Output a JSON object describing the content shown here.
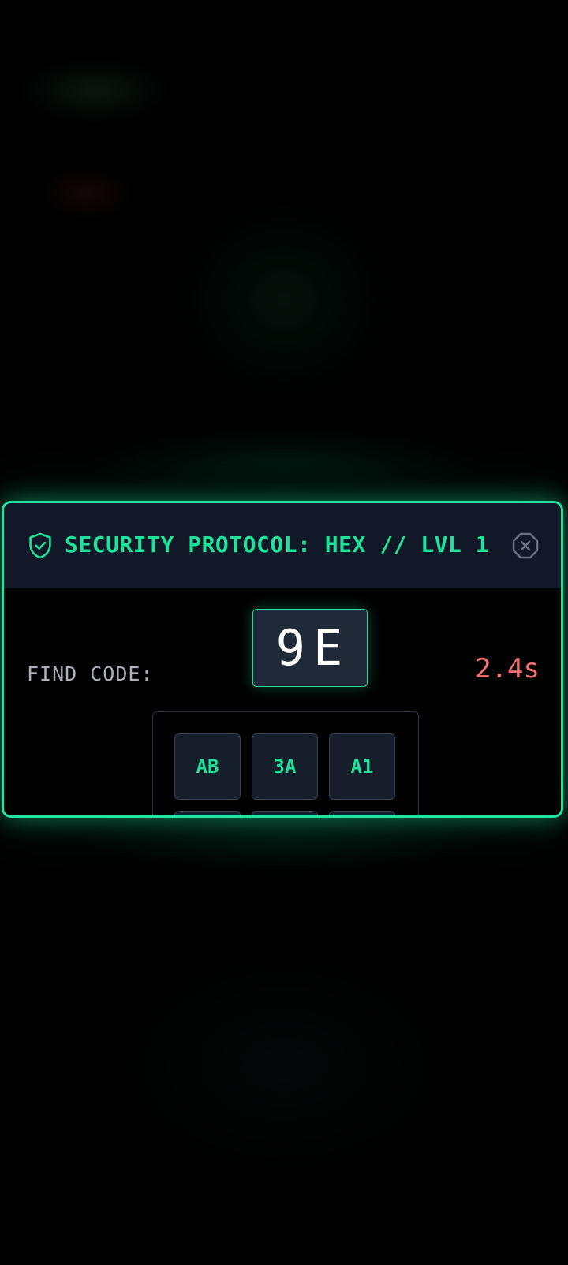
{
  "modal": {
    "title": "SECURITY PROTOCOL: HEX // LVL 1",
    "header_icon": "shield-check-icon",
    "close_icon": "close-octagon-icon",
    "find_label": "FIND CODE:",
    "target_code": "9E",
    "timer": "2.4s",
    "grid": {
      "visible_row": [
        "AB",
        "3A",
        "A1"
      ]
    }
  },
  "colors": {
    "accent": "#22e3a0",
    "title": "#1fe39b",
    "timer": "#f87171",
    "panel": "#111827"
  }
}
